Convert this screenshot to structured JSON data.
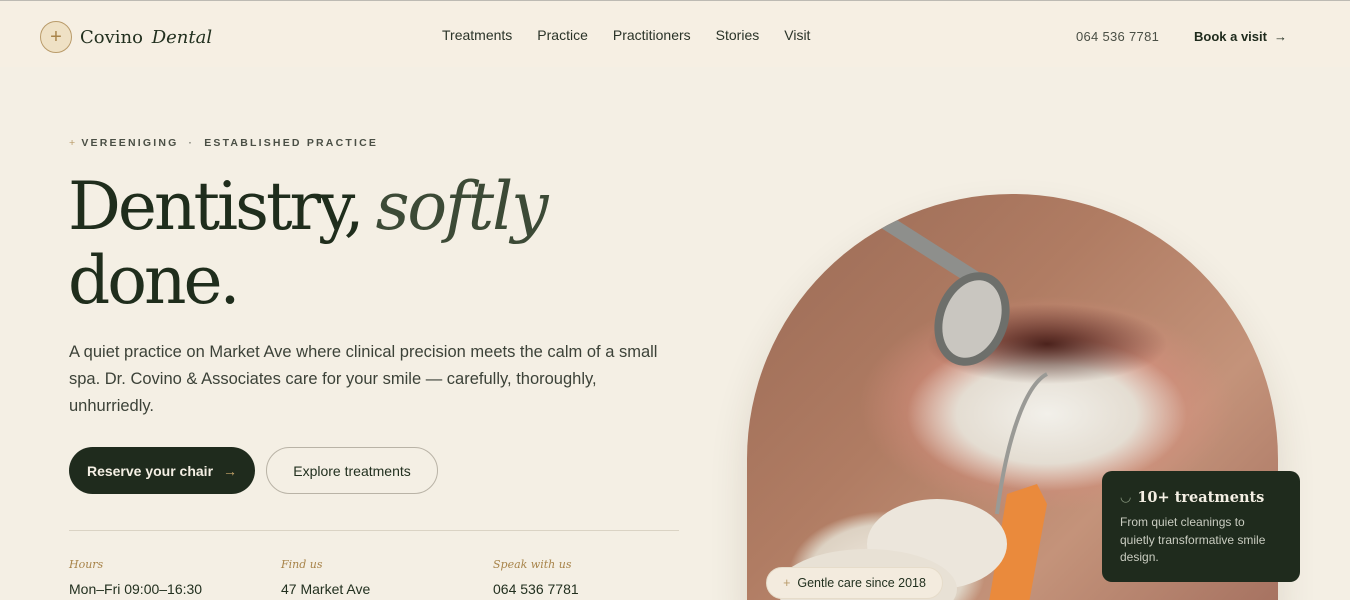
{
  "brand": {
    "name": "Covino",
    "name_italic": "Dental",
    "icon": "plus-star-icon"
  },
  "nav": {
    "items": [
      "Treatments",
      "Practice",
      "Practitioners",
      "Stories",
      "Visit"
    ]
  },
  "header": {
    "phone": "064 536 7781",
    "cta_label": "Book a visit",
    "cta_arrow": "→"
  },
  "hero": {
    "eyebrow_location": "VEREENIGING",
    "eyebrow_separator": "·",
    "eyebrow_tag": "ESTABLISHED PRACTICE",
    "title_line1": "Dentistry,",
    "title_italic": "softly",
    "title_line2": "done.",
    "lead": "A quiet practice on Market Ave where clinical precision meets the calm of a small spa. Dr. Covino & Associates care for your smile — carefully, thoroughly, unhurriedly.",
    "primary_label": "Reserve your chair",
    "primary_arrow": "→",
    "secondary_label": "Explore treatments"
  },
  "info": [
    {
      "label": "Hours",
      "value": "Mon–Fri  09:00–16:30"
    },
    {
      "label": "Find us",
      "value": "47 Market Ave"
    },
    {
      "label": "Speak with us",
      "value": "064 536 7781"
    }
  ],
  "image": {
    "badge_label": "Gentle care since 2018"
  },
  "card": {
    "title": "10+ treatments",
    "description": "From quiet cleanings to quietly transformative smile design.",
    "icon": "tooth-icon"
  },
  "colors": {
    "background": "#f4efe4",
    "ink": "#1f2b1d",
    "accent": "#b99b6a"
  }
}
